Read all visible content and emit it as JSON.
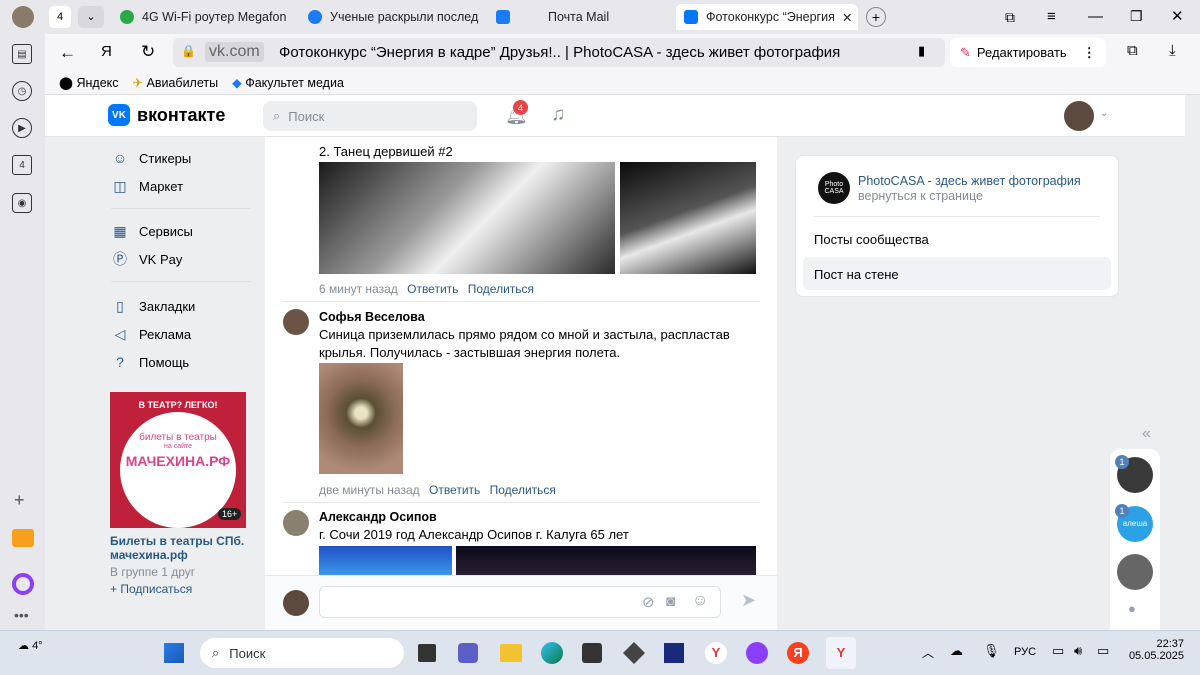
{
  "browser": {
    "tab_count": "4",
    "tabs": [
      {
        "label": "4G Wi-Fi роутер Megafon",
        "icon": "green"
      },
      {
        "label": "Ученые раскрыли послед",
        "icon": "blue-at"
      },
      {
        "label": "Почта Mail",
        "icon": "mail"
      },
      {
        "label": "Фотоконкурс “Энергия",
        "icon": "vk"
      }
    ],
    "address_host": "vk.com",
    "page_title": "Фотоконкурс “Энергия в кадре” Друзья!.. | PhotoCASA - здесь живет фотография",
    "edit_label": "Редактировать",
    "bookmarks": [
      "Яндекс",
      "Авиабилеты",
      "Факультет медиа"
    ],
    "side_badge": "4"
  },
  "vk": {
    "logo": "вконтакте",
    "search_placeholder": "Поиск",
    "notif_count": "4",
    "menu": [
      "Стикеры",
      "Маркет",
      "Сервисы",
      "VK Pay",
      "Закладки",
      "Реклама",
      "Помощь"
    ],
    "ad": {
      "banner_top": "В ТЕАТР? ЛЕГКО!",
      "banner_mid": "билеты в театры",
      "banner_site": "на сайте",
      "banner_brand": "МАЧЕХИНА.РФ",
      "age": "16+",
      "title": "Билеты в театры СПб. мачехина.рф",
      "friends": "В группе 1 друг",
      "subscribe": "+ Подписаться"
    },
    "comments": [
      {
        "text": "2. Танец дервишей #2",
        "time": "6 минут назад",
        "reply": "Ответить",
        "share": "Поделиться"
      },
      {
        "author": "Софья Веселова",
        "text": "Синица приземлилась прямо рядом со мной и застыла, распластав крылья. Получилась - застывшая энергия полета.",
        "time": "две минуты назад",
        "reply": "Ответить",
        "share": "Поделиться"
      },
      {
        "author": "Александр Осипов",
        "text": "г. Сочи 2019 год Александр Осипов г. Калуга 65 лет"
      }
    ],
    "right": {
      "group_name": "PhotoCASA - здесь живет фотография",
      "back": "вернуться к странице",
      "logo_text": "Photo CASA",
      "items": [
        "Посты сообщества",
        "Пост на стене"
      ]
    },
    "chat_badges": [
      "1",
      "1"
    ],
    "chat_brand": "алеша"
  },
  "taskbar": {
    "temp": "4°",
    "search": "Поиск",
    "lang": "РУС",
    "time": "22:37",
    "date": "05.05.2025"
  }
}
